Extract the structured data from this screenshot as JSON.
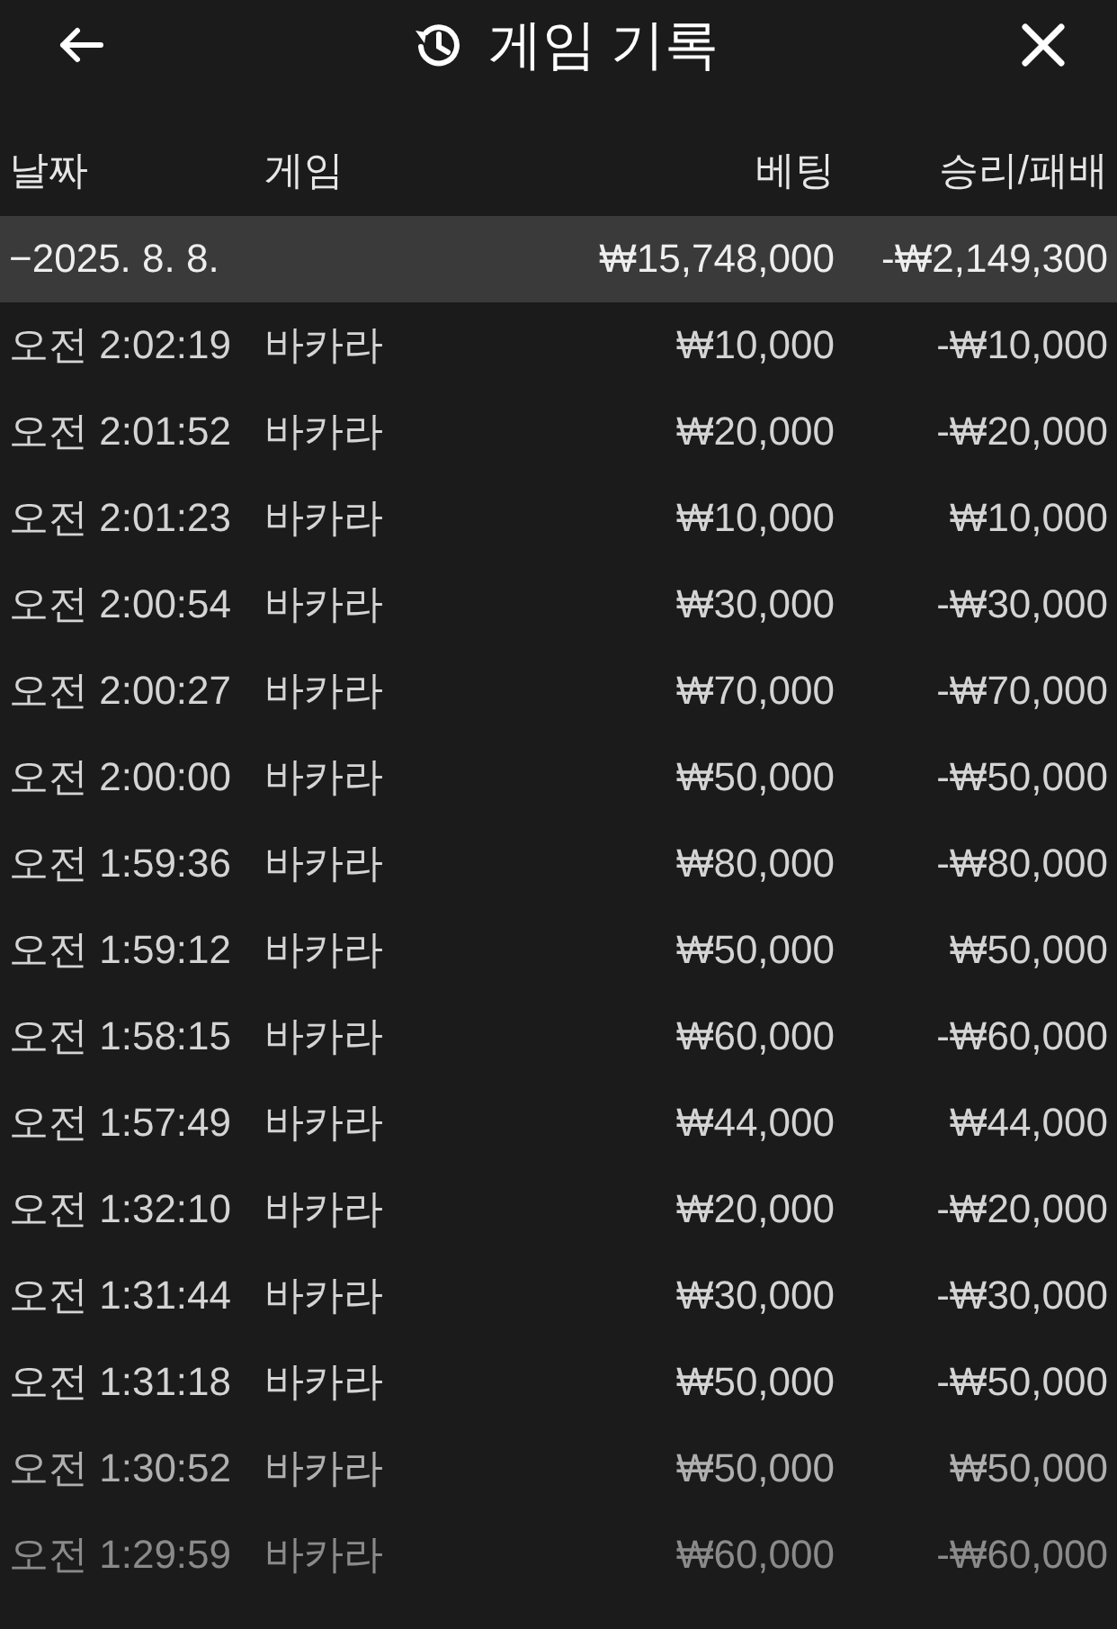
{
  "header": {
    "title": "게임 기록"
  },
  "columns": [
    "날짜",
    "게임",
    "베팅",
    "승리/패배"
  ],
  "group": {
    "toggle": "−",
    "date": "2025. 8. 8.",
    "bet": "₩15,748,000",
    "result": "-₩2,149,300"
  },
  "rows": [
    {
      "time": "오전 2:02:19",
      "game": "바카라",
      "bet": "₩10,000",
      "result": "-₩10,000"
    },
    {
      "time": "오전 2:01:52",
      "game": "바카라",
      "bet": "₩20,000",
      "result": "-₩20,000"
    },
    {
      "time": "오전 2:01:23",
      "game": "바카라",
      "bet": "₩10,000",
      "result": "₩10,000"
    },
    {
      "time": "오전 2:00:54",
      "game": "바카라",
      "bet": "₩30,000",
      "result": "-₩30,000"
    },
    {
      "time": "오전 2:00:27",
      "game": "바카라",
      "bet": "₩70,000",
      "result": "-₩70,000"
    },
    {
      "time": "오전 2:00:00",
      "game": "바카라",
      "bet": "₩50,000",
      "result": "-₩50,000"
    },
    {
      "time": "오전 1:59:36",
      "game": "바카라",
      "bet": "₩80,000",
      "result": "-₩80,000"
    },
    {
      "time": "오전 1:59:12",
      "game": "바카라",
      "bet": "₩50,000",
      "result": "₩50,000"
    },
    {
      "time": "오전 1:58:15",
      "game": "바카라",
      "bet": "₩60,000",
      "result": "-₩60,000"
    },
    {
      "time": "오전 1:57:49",
      "game": "바카라",
      "bet": "₩44,000",
      "result": "₩44,000"
    },
    {
      "time": "오전 1:32:10",
      "game": "바카라",
      "bet": "₩20,000",
      "result": "-₩20,000"
    },
    {
      "time": "오전 1:31:44",
      "game": "바카라",
      "bet": "₩30,000",
      "result": "-₩30,000"
    },
    {
      "time": "오전 1:31:18",
      "game": "바카라",
      "bet": "₩50,000",
      "result": "-₩50,000"
    },
    {
      "time": "오전 1:30:52",
      "game": "바카라",
      "bet": "₩50,000",
      "result": "₩50,000"
    },
    {
      "time": "오전 1:29:59",
      "game": "바카라",
      "bet": "₩60,000",
      "result": "-₩60,000"
    }
  ]
}
